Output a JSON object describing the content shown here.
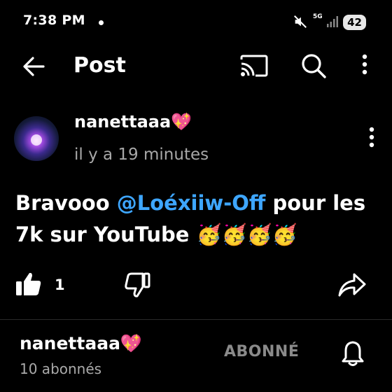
{
  "status": {
    "time": "7:38 PM",
    "network": "5G",
    "battery": "42"
  },
  "appbar": {
    "title": "Post"
  },
  "post": {
    "author": "nanettaaa💖",
    "time_ago": "il y a 19 minutes",
    "text_before": "Bravooo ",
    "mention": "@Loéxiiw-Off",
    "text_after": "  pour les 7k sur YouTube 🥳🥳🥳🥳",
    "likes": "1"
  },
  "channel": {
    "name": "nanettaaa💖",
    "subscribers": "10 abonnés",
    "subscribe_label": "ABONNÉ"
  },
  "icons": {
    "back": "arrow-left-icon",
    "cast": "cast-icon",
    "search": "search-icon",
    "more": "more-vert-icon",
    "like": "thumbs-up-icon",
    "dislike": "thumbs-down-icon",
    "share": "share-icon",
    "bell": "bell-icon"
  }
}
